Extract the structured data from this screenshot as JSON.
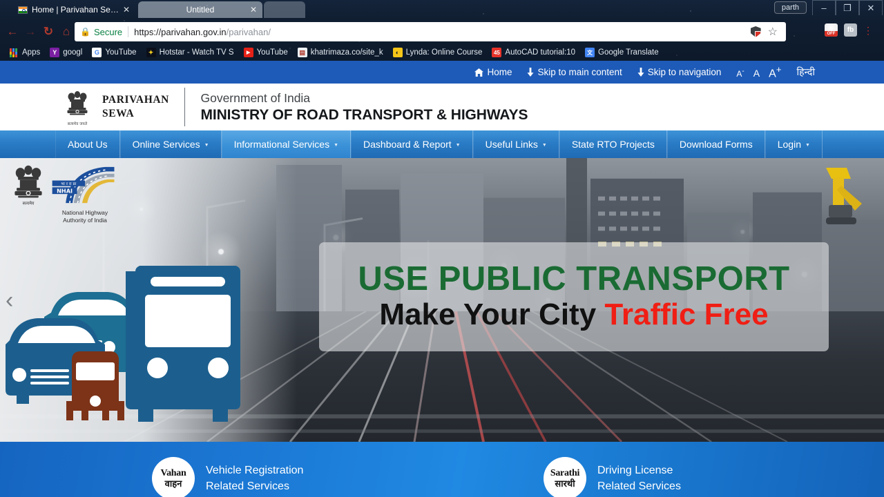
{
  "browser": {
    "tabs": [
      {
        "title": "Home | Parivahan Sewa",
        "active": true,
        "favicon": "india-flag-favicon"
      },
      {
        "title": "Untitled",
        "active": false
      }
    ],
    "window": {
      "user_label": "parth",
      "minimize": "–",
      "restore": "❐",
      "close": "✕"
    },
    "toolbar": {
      "back": "←",
      "forward": "→",
      "reload": "↻",
      "home": "⌂",
      "lock_icon": "🔒",
      "secure_label": "Secure",
      "url_domain": "https://parivahan.gov.in",
      "url_path": "/parivahan/",
      "star_icon": "☆",
      "menu_icon": "⋮",
      "ext_fb_label": "fb",
      "ext_off_label": "OFF"
    },
    "bookmarks": [
      {
        "label": "Apps",
        "icon": "apps-grid-icon",
        "color": ""
      },
      {
        "label": "googl",
        "icon": "yahoo-icon",
        "color": "#7b1fa2",
        "glyph": "Y"
      },
      {
        "label": "YouTube",
        "icon": "google-icon",
        "color": "#ffffff",
        "glyph": "G"
      },
      {
        "label": "Hotstar - Watch TV S",
        "icon": "hotstar-icon",
        "color": "#0b0f1a",
        "glyph": "✦"
      },
      {
        "label": "YouTube",
        "icon": "youtube-icon",
        "color": "#e62117",
        "glyph": "▶"
      },
      {
        "label": "khatrimaza.co/site_k",
        "icon": "page-icon",
        "color": "#eceff1",
        "glyph": "▤"
      },
      {
        "label": "Lynda: Online Course",
        "icon": "lynda-icon",
        "color": "#f5c518",
        "glyph": "◐"
      },
      {
        "label": "AutoCAD tutorial:10",
        "icon": "autocad-icon",
        "color": "#e8332a",
        "glyph": "45"
      },
      {
        "label": "Google Translate",
        "icon": "translate-icon",
        "color": "#4285f4",
        "glyph": "文"
      }
    ]
  },
  "utility_bar": {
    "home": "Home",
    "home_icon": "home-icon",
    "skip_main": "Skip to main content",
    "skip_nav": "Skip to navigation",
    "down_arrow_icon": "↓",
    "font_small": "A",
    "font_small_sup": "-",
    "font_normal": "A",
    "font_large": "A",
    "font_large_sup": "+",
    "language": "हिन्दी"
  },
  "masthead": {
    "emblem_icon": "ashoka-lion-capital-emblem",
    "emblem_motto": "सत्यमेव जयते",
    "brand_line1": "PARIVAHAN",
    "brand_line2": "SEWA",
    "government": "Government of India",
    "ministry": "MINISTRY OF ROAD TRANSPORT & HIGHWAYS"
  },
  "menu": {
    "items": [
      {
        "label": "About Us",
        "has_caret": false,
        "hover": false
      },
      {
        "label": "Online Services",
        "has_caret": true,
        "hover": false
      },
      {
        "label": "Informational Services",
        "has_caret": true,
        "hover": true
      },
      {
        "label": "Dashboard & Report",
        "has_caret": true,
        "hover": false
      },
      {
        "label": "Useful Links",
        "has_caret": true,
        "hover": false
      },
      {
        "label": "State RTO Projects",
        "has_caret": false,
        "hover": false
      },
      {
        "label": "Download Forms",
        "has_caret": false,
        "hover": false
      },
      {
        "label": "Login",
        "has_caret": true,
        "hover": false
      }
    ],
    "caret_glyph": "▼"
  },
  "hero": {
    "prev_arrow": "‹",
    "nhai": {
      "emblem_icon": "ashoka-lion-capital-emblem",
      "emblem_motto": "सत्यमेव जयते",
      "logo_icon": "nhai-highway-logo",
      "logo_hindi": "भा र रा प्रा",
      "logo_abbr": "NHAI",
      "caption_line1": "National Highway",
      "caption_line2": "Authority of India"
    },
    "caption": {
      "line1": "USE PUBLIC TRANSPORT",
      "line2_black": "Make Your City",
      "line2_red": "Traffic Free"
    },
    "vehicles_icon": "bus-cars-autorickshaw-illustration",
    "crane_icon": "yellow-construction-crane"
  },
  "services": [
    {
      "badge_en": "Vahan",
      "badge_hi": "वाहन",
      "title": "Vehicle Registration",
      "subtitle": "Related Services"
    },
    {
      "badge_en": "Sarathi",
      "badge_hi": "सारथी",
      "title": "Driving License",
      "subtitle": "Related Services"
    }
  ],
  "colors": {
    "util_bar_blue": "#1e5bb8",
    "menu_blue": "#2a7cc6",
    "menu_hover_blue": "#5aa8e4",
    "service_blue": "#1b78d4",
    "caption_green": "#1a6b33",
    "caption_red": "#f01e14",
    "secure_green": "#0a8043"
  }
}
